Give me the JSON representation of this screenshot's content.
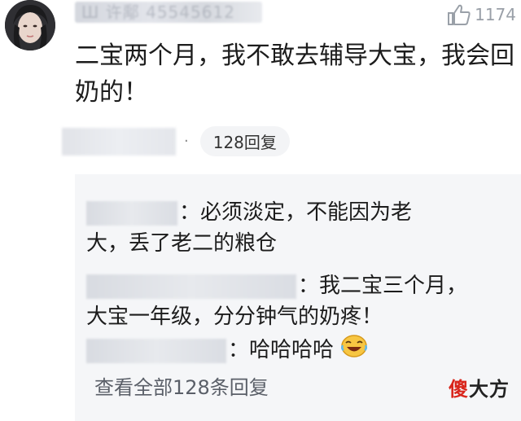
{
  "comment": {
    "username": "Ш 许鄅 45545612",
    "likes": "1174",
    "text": "二宝两个月，我不敢去辅导大宝，我会回奶的！",
    "reply_count_label": "128回复"
  },
  "replies": [
    {
      "text": "：必须淡定，不能因为老大，丢了老二的粮仓"
    },
    {
      "text": "：我二宝三个月，大宝一年级，分分钟气的奶疼！"
    },
    {
      "text": "：哈哈哈哈"
    }
  ],
  "view_all_label": "查看全部128条回复",
  "watermark": {
    "first": "傻",
    "rest": "大方"
  },
  "colors": {
    "reply_bg": "#f5f6f8",
    "watermark_accent": "#d9261c",
    "like_icon": "#9aa0a8"
  }
}
